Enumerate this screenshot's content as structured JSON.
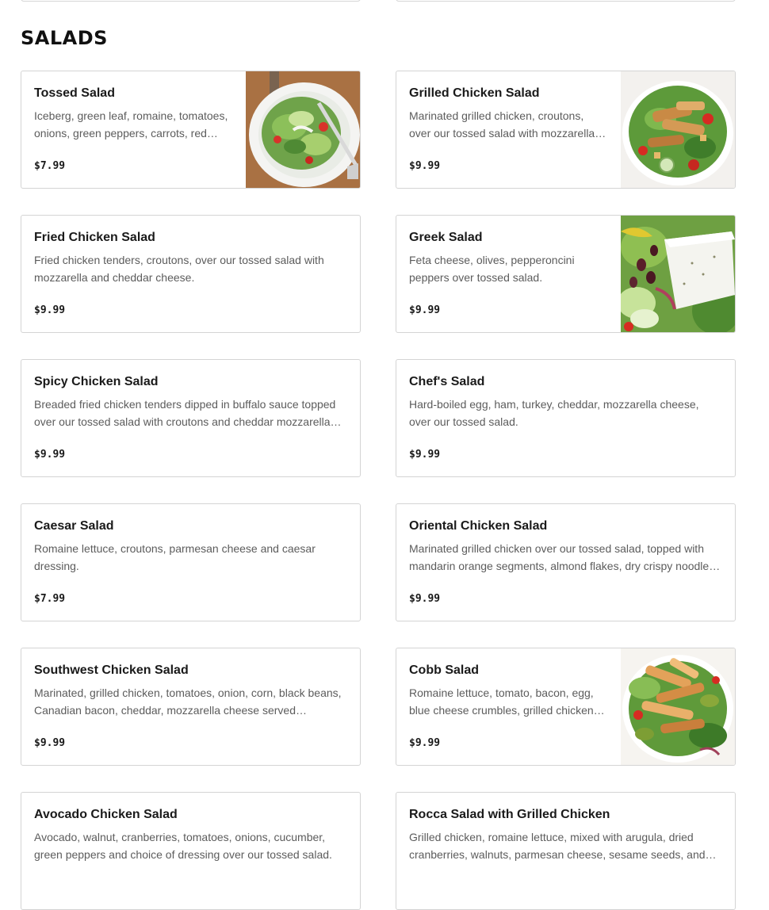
{
  "section": {
    "title": "SALADS"
  },
  "items": [
    {
      "name": "Tossed Salad",
      "description": "Iceberg, green leaf, romaine, tomatoes, onions, green peppers, carrots, red…",
      "price": "$7.99",
      "image": "tossed-salad-photo"
    },
    {
      "name": "Grilled Chicken Salad",
      "description": "Marinated grilled chicken, croutons, over our tossed salad with mozzarella…",
      "price": "$9.99",
      "image": "grilled-chicken-salad-photo"
    },
    {
      "name": "Fried Chicken Salad",
      "description": "Fried chicken tenders, croutons, over our tossed salad with mozzarella and cheddar cheese.",
      "price": "$9.99",
      "image": null
    },
    {
      "name": "Greek Salad",
      "description": "Feta cheese, olives, pepperoncini peppers over tossed salad.",
      "price": "$9.99",
      "image": "greek-salad-photo"
    },
    {
      "name": "Spicy Chicken Salad",
      "description": "Breaded fried chicken tenders dipped in buffalo sauce topped over our tossed salad with croutons and cheddar mozzarella…",
      "price": "$9.99",
      "image": null
    },
    {
      "name": "Chef's Salad",
      "description": "Hard-boiled egg, ham, turkey, cheddar, mozzarella cheese, over our tossed salad.",
      "price": "$9.99",
      "image": null
    },
    {
      "name": "Caesar Salad",
      "description": "Romaine lettuce, croutons, parmesan cheese and caesar dressing.",
      "price": "$7.99",
      "image": null
    },
    {
      "name": "Oriental Chicken Salad",
      "description": "Marinated grilled chicken over our tossed salad, topped with mandarin orange segments, almond flakes, dry crispy noodle…",
      "price": "$9.99",
      "image": null
    },
    {
      "name": "Southwest Chicken Salad",
      "description": "Marinated, grilled chicken, tomatoes, onion, corn, black beans, Canadian bacon, cheddar, mozzarella cheese served…",
      "price": "$9.99",
      "image": null
    },
    {
      "name": "Cobb Salad",
      "description": "Romaine lettuce, tomato, bacon, egg, blue cheese crumbles, grilled chicken…",
      "price": "$9.99",
      "image": "cobb-salad-photo"
    },
    {
      "name": "Avocado Chicken Salad",
      "description": "Avocado, walnut, cranberries, tomatoes, onions, cucumber, green peppers and choice of dressing over our tossed salad.",
      "price": "",
      "image": null
    },
    {
      "name": "Rocca Salad with Grilled Chicken",
      "description": "Grilled chicken, romaine lettuce, mixed with arugula, dried cranberries, walnuts, parmesan cheese, sesame seeds, and…",
      "price": "",
      "image": null
    }
  ]
}
